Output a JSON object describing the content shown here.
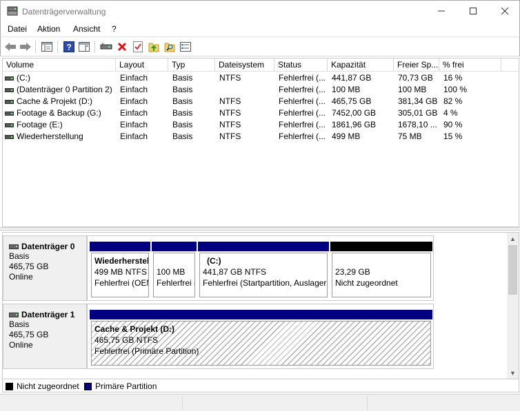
{
  "window": {
    "title": "Datenträgerverwaltung"
  },
  "menu": {
    "items": [
      "Datei",
      "Aktion",
      "Ansicht",
      "?"
    ]
  },
  "toolbar": {
    "buttons": [
      "back-icon",
      "forward-icon",
      "console-icon",
      "help-icon",
      "action-pane-icon",
      "connect-icon",
      "delete-icon",
      "properties-icon",
      "import-icon",
      "search-icon",
      "list-icon"
    ]
  },
  "volume_table": {
    "columns": [
      "Volume",
      "Layout",
      "Typ",
      "Dateisystem",
      "Status",
      "Kapazität",
      "Freier Sp...",
      "% frei"
    ],
    "rows": [
      {
        "volume": " (C:)",
        "layout": "Einfach",
        "typ": "Basis",
        "fs": "NTFS",
        "status": "Fehlerfrei (...",
        "kapazitaet": "441,87 GB",
        "frei": "70,73 GB",
        "prozent": "16 %"
      },
      {
        "volume": "(Datenträger 0 Partition 2)",
        "layout": "Einfach",
        "typ": "Basis",
        "fs": "",
        "status": "Fehlerfrei (...",
        "kapazitaet": "100 MB",
        "frei": "100 MB",
        "prozent": "100 %"
      },
      {
        "volume": "Cache & Projekt (D:)",
        "layout": "Einfach",
        "typ": "Basis",
        "fs": "NTFS",
        "status": "Fehlerfrei (...",
        "kapazitaet": "465,75 GB",
        "frei": "381,34 GB",
        "prozent": "82 %"
      },
      {
        "volume": "Footage & Backup (G:)",
        "layout": "Einfach",
        "typ": "Basis",
        "fs": "NTFS",
        "status": "Fehlerfrei (...",
        "kapazitaet": "7452,00 GB",
        "frei": "305,01 GB",
        "prozent": "4 %"
      },
      {
        "volume": "Footage (E:)",
        "layout": "Einfach",
        "typ": "Basis",
        "fs": "NTFS",
        "status": "Fehlerfrei (...",
        "kapazitaet": "1861,96 GB",
        "frei": "1678,10 ...",
        "prozent": "90 %"
      },
      {
        "volume": "Wiederherstellung",
        "layout": "Einfach",
        "typ": "Basis",
        "fs": "NTFS",
        "status": "Fehlerfrei (...",
        "kapazitaet": "499 MB",
        "frei": "75 MB",
        "prozent": "15 %"
      }
    ]
  },
  "disks": [
    {
      "name": "Datenträger 0",
      "type": "Basis",
      "size": "465,75 GB",
      "state": "Online",
      "partitions": [
        {
          "title": "Wiederherstellung",
          "line2": "499 MB NTFS",
          "line3": "Fehlerfrei (OEM-Partition)",
          "bar_color": "#000080"
        },
        {
          "title": "",
          "line2": "100 MB",
          "line3": "Fehlerfrei (EFI-Systempartition)",
          "bar_color": "#000080"
        },
        {
          "title": "(C:)",
          "line2": "441,87 GB NTFS",
          "line3": "Fehlerfrei (Startpartition, Auslagerungsdatei)",
          "bar_color": "#000080"
        },
        {
          "title": "",
          "line2": "23,29 GB",
          "line3": "Nicht zugeordnet",
          "bar_color": "#000000"
        }
      ]
    },
    {
      "name": "Datenträger 1",
      "type": "Basis",
      "size": "465,75 GB",
      "state": "Online",
      "partitions": [
        {
          "title": "Cache & Projekt  (D:)",
          "line2": "465,75 GB NTFS",
          "line3": "Fehlerfrei (Primäre Partition)",
          "bar_color": "#000080"
        }
      ]
    }
  ],
  "legend": [
    {
      "label": "Nicht zugeordnet",
      "color": "#000000"
    },
    {
      "label": "Primäre Partition",
      "color": "#000080"
    }
  ]
}
